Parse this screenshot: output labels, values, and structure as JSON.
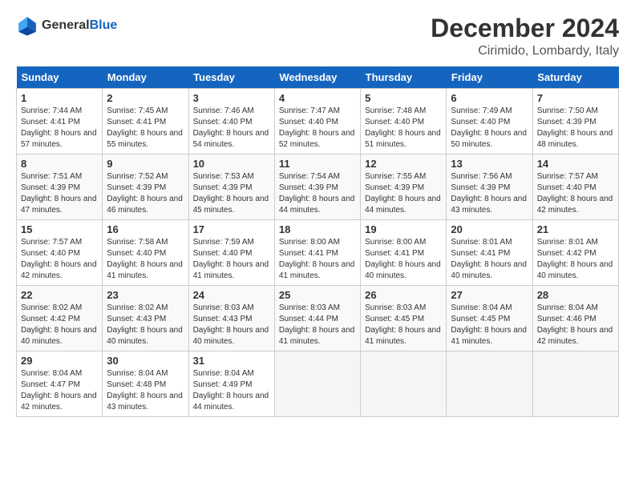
{
  "header": {
    "logo_line1": "General",
    "logo_line2": "Blue",
    "month": "December 2024",
    "location": "Cirimido, Lombardy, Italy"
  },
  "weekdays": [
    "Sunday",
    "Monday",
    "Tuesday",
    "Wednesday",
    "Thursday",
    "Friday",
    "Saturday"
  ],
  "weeks": [
    [
      {
        "day": 1,
        "rise": "7:44 AM",
        "set": "4:41 PM",
        "daylight": "8 hours and 57 minutes."
      },
      {
        "day": 2,
        "rise": "7:45 AM",
        "set": "4:41 PM",
        "daylight": "8 hours and 55 minutes."
      },
      {
        "day": 3,
        "rise": "7:46 AM",
        "set": "4:40 PM",
        "daylight": "8 hours and 54 minutes."
      },
      {
        "day": 4,
        "rise": "7:47 AM",
        "set": "4:40 PM",
        "daylight": "8 hours and 52 minutes."
      },
      {
        "day": 5,
        "rise": "7:48 AM",
        "set": "4:40 PM",
        "daylight": "8 hours and 51 minutes."
      },
      {
        "day": 6,
        "rise": "7:49 AM",
        "set": "4:40 PM",
        "daylight": "8 hours and 50 minutes."
      },
      {
        "day": 7,
        "rise": "7:50 AM",
        "set": "4:39 PM",
        "daylight": "8 hours and 48 minutes."
      }
    ],
    [
      {
        "day": 8,
        "rise": "7:51 AM",
        "set": "4:39 PM",
        "daylight": "8 hours and 47 minutes."
      },
      {
        "day": 9,
        "rise": "7:52 AM",
        "set": "4:39 PM",
        "daylight": "8 hours and 46 minutes."
      },
      {
        "day": 10,
        "rise": "7:53 AM",
        "set": "4:39 PM",
        "daylight": "8 hours and 45 minutes."
      },
      {
        "day": 11,
        "rise": "7:54 AM",
        "set": "4:39 PM",
        "daylight": "8 hours and 44 minutes."
      },
      {
        "day": 12,
        "rise": "7:55 AM",
        "set": "4:39 PM",
        "daylight": "8 hours and 44 minutes."
      },
      {
        "day": 13,
        "rise": "7:56 AM",
        "set": "4:39 PM",
        "daylight": "8 hours and 43 minutes."
      },
      {
        "day": 14,
        "rise": "7:57 AM",
        "set": "4:40 PM",
        "daylight": "8 hours and 42 minutes."
      }
    ],
    [
      {
        "day": 15,
        "rise": "7:57 AM",
        "set": "4:40 PM",
        "daylight": "8 hours and 42 minutes."
      },
      {
        "day": 16,
        "rise": "7:58 AM",
        "set": "4:40 PM",
        "daylight": "8 hours and 41 minutes."
      },
      {
        "day": 17,
        "rise": "7:59 AM",
        "set": "4:40 PM",
        "daylight": "8 hours and 41 minutes."
      },
      {
        "day": 18,
        "rise": "8:00 AM",
        "set": "4:41 PM",
        "daylight": "8 hours and 41 minutes."
      },
      {
        "day": 19,
        "rise": "8:00 AM",
        "set": "4:41 PM",
        "daylight": "8 hours and 40 minutes."
      },
      {
        "day": 20,
        "rise": "8:01 AM",
        "set": "4:41 PM",
        "daylight": "8 hours and 40 minutes."
      },
      {
        "day": 21,
        "rise": "8:01 AM",
        "set": "4:42 PM",
        "daylight": "8 hours and 40 minutes."
      }
    ],
    [
      {
        "day": 22,
        "rise": "8:02 AM",
        "set": "4:42 PM",
        "daylight": "8 hours and 40 minutes."
      },
      {
        "day": 23,
        "rise": "8:02 AM",
        "set": "4:43 PM",
        "daylight": "8 hours and 40 minutes."
      },
      {
        "day": 24,
        "rise": "8:03 AM",
        "set": "4:43 PM",
        "daylight": "8 hours and 40 minutes."
      },
      {
        "day": 25,
        "rise": "8:03 AM",
        "set": "4:44 PM",
        "daylight": "8 hours and 41 minutes."
      },
      {
        "day": 26,
        "rise": "8:03 AM",
        "set": "4:45 PM",
        "daylight": "8 hours and 41 minutes."
      },
      {
        "day": 27,
        "rise": "8:04 AM",
        "set": "4:45 PM",
        "daylight": "8 hours and 41 minutes."
      },
      {
        "day": 28,
        "rise": "8:04 AM",
        "set": "4:46 PM",
        "daylight": "8 hours and 42 minutes."
      }
    ],
    [
      {
        "day": 29,
        "rise": "8:04 AM",
        "set": "4:47 PM",
        "daylight": "8 hours and 42 minutes."
      },
      {
        "day": 30,
        "rise": "8:04 AM",
        "set": "4:48 PM",
        "daylight": "8 hours and 43 minutes."
      },
      {
        "day": 31,
        "rise": "8:04 AM",
        "set": "4:49 PM",
        "daylight": "8 hours and 44 minutes."
      },
      null,
      null,
      null,
      null
    ]
  ]
}
